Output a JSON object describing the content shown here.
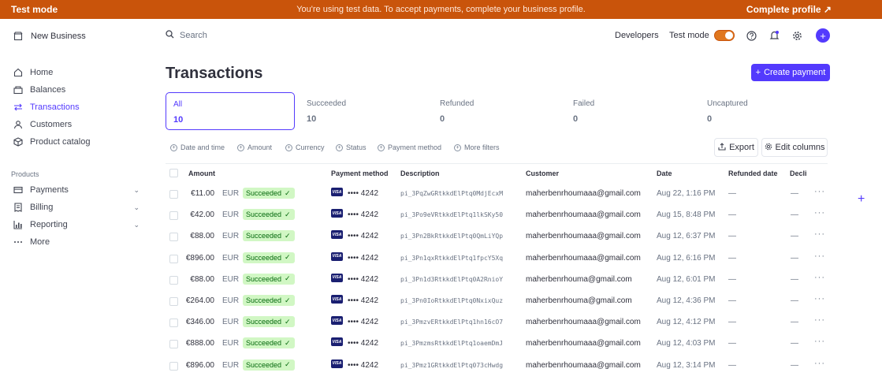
{
  "banner": {
    "mode": "Test mode",
    "message": "You're using test data. To accept payments, complete your business profile.",
    "cta": "Complete profile ↗",
    "color": "#c9540b"
  },
  "sidebar": {
    "brand": "New Business",
    "items": [
      {
        "label": "Home",
        "icon": "home-icon"
      },
      {
        "label": "Balances",
        "icon": "balances-icon"
      },
      {
        "label": "Transactions",
        "icon": "transactions-icon",
        "active": true
      },
      {
        "label": "Customers",
        "icon": "customers-icon"
      },
      {
        "label": "Product catalog",
        "icon": "product-catalog-icon"
      }
    ],
    "section": "Products",
    "products": [
      {
        "label": "Payments",
        "icon": "payments-icon"
      },
      {
        "label": "Billing",
        "icon": "billing-icon"
      },
      {
        "label": "Reporting",
        "icon": "reporting-icon"
      },
      {
        "label": "More",
        "icon": "more-icon"
      }
    ]
  },
  "header": {
    "search_placeholder": "Search",
    "developers": "Developers",
    "test_mode": "Test mode"
  },
  "page": {
    "title": "Transactions",
    "create_payment": "Create payment",
    "accent": "#533afd"
  },
  "status_tabs": [
    {
      "label": "All",
      "count": "10",
      "active": true
    },
    {
      "label": "Succeeded",
      "count": "10"
    },
    {
      "label": "Refunded",
      "count": "0"
    },
    {
      "label": "Failed",
      "count": "0"
    },
    {
      "label": "Uncaptured",
      "count": "0"
    }
  ],
  "filters": [
    "Date and time",
    "Amount",
    "Currency",
    "Status",
    "Payment method",
    "More filters"
  ],
  "toolbar": {
    "export": "Export",
    "edit_columns": "Edit columns"
  },
  "table": {
    "columns": [
      "Amount",
      "Payment method",
      "Description",
      "Customer",
      "Date",
      "Refunded date",
      "Decli"
    ],
    "rows": [
      {
        "amount": "€11.00",
        "currency": "EUR",
        "status": "Succeeded",
        "card": "•••• 4242",
        "description": "pi_3PqZwGRtkkdElPtq0MdjEcxM",
        "customer": "maherbenrhoumaaa@gmail.com",
        "date": "Aug 22, 1:16 PM",
        "refunded": "—",
        "declined": "—"
      },
      {
        "amount": "€42.00",
        "currency": "EUR",
        "status": "Succeeded",
        "card": "•••• 4242",
        "description": "pi_3Po9eVRtkkdElPtq1lkSKy50",
        "customer": "maherbenrhoumaaa@gmail.com",
        "date": "Aug 15, 8:48 PM",
        "refunded": "—",
        "declined": "—"
      },
      {
        "amount": "€88.00",
        "currency": "EUR",
        "status": "Succeeded",
        "card": "•••• 4242",
        "description": "pi_3Pn2BkRtkkdElPtq0QmLiYQp",
        "customer": "maherbenrhoumaaa@gmail.com",
        "date": "Aug 12, 6:37 PM",
        "refunded": "—",
        "declined": "—"
      },
      {
        "amount": "€896.00",
        "currency": "EUR",
        "status": "Succeeded",
        "card": "•••• 4242",
        "description": "pi_3Pn1qxRtkkdElPtq1fpcY5Xq",
        "customer": "maherbenrhoumaaa@gmail.com",
        "date": "Aug 12, 6:16 PM",
        "refunded": "—",
        "declined": "—"
      },
      {
        "amount": "€88.00",
        "currency": "EUR",
        "status": "Succeeded",
        "card": "•••• 4242",
        "description": "pi_3Pn1d3RtkkdElPtq0A2RnioY",
        "customer": "maherbenrhouma@gmail.com",
        "date": "Aug 12, 6:01 PM",
        "refunded": "—",
        "declined": "—"
      },
      {
        "amount": "€264.00",
        "currency": "EUR",
        "status": "Succeeded",
        "card": "•••• 4242",
        "description": "pi_3Pn0IoRtkkdElPtq0NxixQuz",
        "customer": "maherbenrhouma@gmail.com",
        "date": "Aug 12, 4:36 PM",
        "refunded": "—",
        "declined": "—"
      },
      {
        "amount": "€346.00",
        "currency": "EUR",
        "status": "Succeeded",
        "card": "•••• 4242",
        "description": "pi_3PmzvERtkkdElPtq1hn16cO7",
        "customer": "maherbenrhoumaaa@gmail.com",
        "date": "Aug 12, 4:12 PM",
        "refunded": "—",
        "declined": "—"
      },
      {
        "amount": "€888.00",
        "currency": "EUR",
        "status": "Succeeded",
        "card": "•••• 4242",
        "description": "pi_3PmzmsRtkkdElPtq1oaemDmJ",
        "customer": "maherbenrhoumaaa@gmail.com",
        "date": "Aug 12, 4:03 PM",
        "refunded": "—",
        "declined": "—"
      },
      {
        "amount": "€896.00",
        "currency": "EUR",
        "status": "Succeeded",
        "card": "•••• 4242",
        "description": "pi_3Pmz1GRtkkdElPtq073cHwdg",
        "customer": "maherbenrhoumaaa@gmail.com",
        "date": "Aug 12, 3:14 PM",
        "refunded": "—",
        "declined": "—"
      }
    ]
  }
}
